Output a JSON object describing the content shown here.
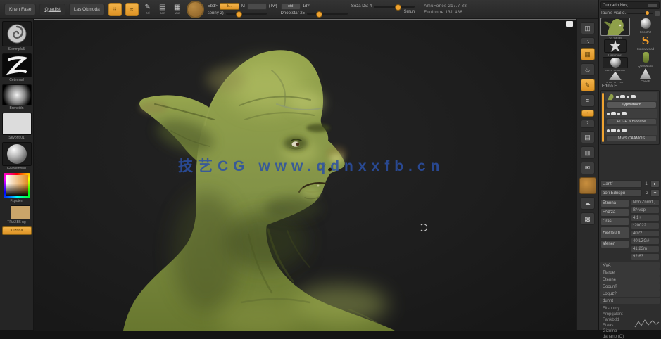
{
  "colors": {
    "accent": "#f0a330",
    "watermark": "#2b50a5",
    "skin": "#8a9a47"
  },
  "topbar": {
    "buttons": [
      {
        "label": "Knen Fase"
      },
      {
        "label": "Quadist"
      },
      {
        "label": "Las Okmoda"
      }
    ],
    "toggles": [
      {
        "glyph": "⁝⁝"
      },
      {
        "glyph": "≈"
      }
    ],
    "tool_icons": [
      {
        "glyph": "✎",
        "label": "zcl"
      },
      {
        "glyph": "▤",
        "label": "aon"
      },
      {
        "glyph": "▦",
        "label": "vne"
      }
    ],
    "field": {
      "label": "Ebd>",
      "value": "b..",
      "unit": "M",
      "extra": "(Tw)"
    },
    "slider1": {
      "label": "senny 2)"
    },
    "mini1": "utd",
    "mini2": "1d?",
    "slider2": {
      "label": "Dnootstar 25"
    },
    "slider3": {
      "label": "Soza Dv: 4"
    },
    "smun": "Smun",
    "readout1": "AmuFones 217.7 88",
    "readout2": "Fuulnnoe 131.486"
  },
  "left_shelf": {
    "items": [
      {
        "label": "Sienmplu5"
      },
      {
        "label": "Ceterrnal"
      },
      {
        "label": "Brenstdn"
      },
      {
        "label": "Sevont 01"
      },
      {
        "label": "Gwoletnnnd"
      },
      {
        "label": "Fzpoten"
      },
      {
        "label": "TRAXB5 ng"
      },
      {
        "label": "Kliznna"
      }
    ]
  },
  "canvas": {
    "watermark": "技艺CG  www.qdnxxfb.cn"
  },
  "right_shelf": {
    "items": [
      {
        "glyph": "◫"
      },
      {
        "glyph": "⋱"
      },
      {
        "glyph": "▦"
      },
      {
        "glyph": "♨"
      },
      {
        "glyph": "✎"
      },
      {
        "glyph": "≡"
      },
      {
        "glyph": "▪"
      },
      {
        "glyph": "?"
      },
      {
        "glyph": "▤"
      },
      {
        "glyph": "▥"
      },
      {
        "glyph": "✉"
      },
      {
        "glyph": ""
      },
      {
        "glyph": "☁"
      },
      {
        "glyph": "▩"
      }
    ]
  },
  "right_tray": {
    "header1": "Cunradb Nov,",
    "header2": "Taun's vital d.",
    "tools": [
      {
        "label": "3d 2d LB"
      },
      {
        "label": "Snooth2"
      },
      {
        "label": "Sotewtwnad",
        "glyph": "S"
      },
      {
        "label": "Lissvmpst"
      },
      {
        "label": "Qooswtut5"
      },
      {
        "label": "RscCStunuke"
      },
      {
        "label": "CaneB"
      },
      {
        "label": "4.99,3LCnad"
      }
    ],
    "subtool": {
      "header": "Edmo E",
      "rows": [
        {
          "name": "Typvwbocd"
        },
        {
          "name": "PLGH a Blooxbe"
        },
        {
          "name": "MMS CAAMOS"
        }
      ]
    },
    "sliders": [
      {
        "label": "Uantf",
        "value": "1",
        "btn": "▸"
      },
      {
        "label": "aori Ednspu",
        "value": "-2",
        "btn": "✦"
      }
    ],
    "grid_left": [
      "Etnnna",
      "FAd'za",
      "Cras",
      "+aensum",
      "afener"
    ],
    "grid_right": [
      "Non Znmrt.,",
      "BNvop",
      "4.1+",
      "*20022",
      "4022",
      "40 LZG#",
      "41.23m",
      "92.63"
    ],
    "list": [
      "KVA",
      "Tlarue",
      "Etenne",
      "Eooun?",
      "Loquz?",
      "dunnt"
    ],
    "below": [
      "Fitsuumy",
      "Ampgalent",
      "Fankbdd",
      "Etaas",
      "Giznlnb",
      "dananp (O)"
    ]
  }
}
